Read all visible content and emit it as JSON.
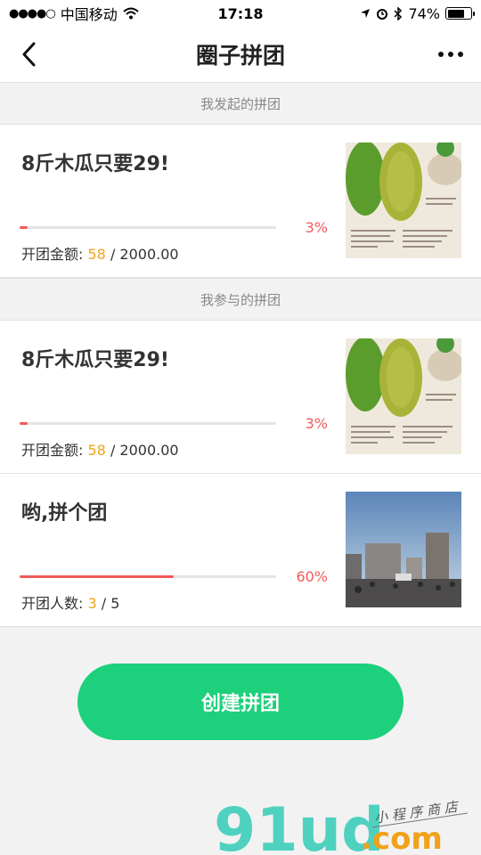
{
  "status": {
    "carrier": "中国移动",
    "time": "17:18",
    "battery_pct": "74%",
    "battery_level": 0.74
  },
  "nav": {
    "title": "圈子拼团"
  },
  "sections": [
    {
      "header": "我发起的拼团",
      "cards": [
        {
          "title": "8斤木瓜只要29!",
          "progress": 0.03,
          "progress_text": "3%",
          "meta_label": "开团金额:",
          "meta_value": "58",
          "meta_sep": " / ",
          "meta_total": "2000.00",
          "thumb": "papaya-image"
        }
      ]
    },
    {
      "header": "我参与的拼团",
      "cards": [
        {
          "title": "8斤木瓜只要29!",
          "progress": 0.03,
          "progress_text": "3%",
          "meta_label": "开团金额:",
          "meta_value": "58",
          "meta_sep": " / ",
          "meta_total": "2000.00",
          "thumb": "papaya-image"
        },
        {
          "title": "哟,拼个团",
          "progress": 0.6,
          "progress_text": "60%",
          "meta_label": "开团人数:",
          "meta_value": "3",
          "meta_sep": " / ",
          "meta_total": "5",
          "thumb": "street-photo-image"
        }
      ]
    }
  ],
  "actions": {
    "create_label": "创建拼团"
  },
  "watermark": {
    "brand": "91ud",
    "domain": ".com",
    "tagline": "小程序商店"
  },
  "colors": {
    "accent_green": "#1dd07b",
    "progress_red": "#f25a5a",
    "highlight_orange": "#f0a21a"
  }
}
